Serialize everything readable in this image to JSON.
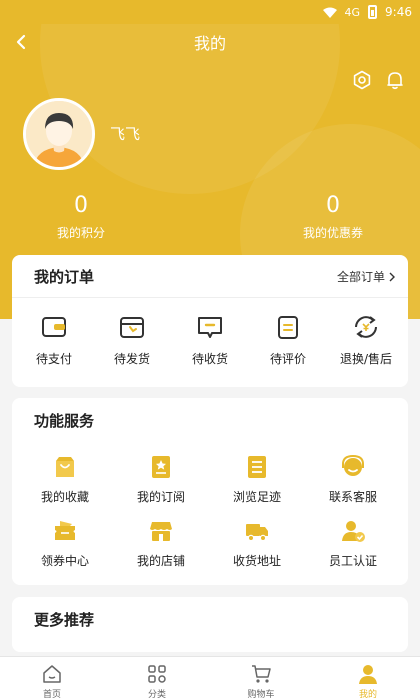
{
  "status_bar": {
    "time": "9:46",
    "signal_text": "4G"
  },
  "header": {
    "title": "我的"
  },
  "profile": {
    "username": "飞飞"
  },
  "stats": [
    {
      "value": "0",
      "label": "我的积分"
    },
    {
      "value": "0",
      "label": "我的优惠券"
    }
  ],
  "orders": {
    "title": "我的订单",
    "all_label": "全部订单",
    "items": [
      {
        "label": "待支付",
        "icon": "wallet-icon"
      },
      {
        "label": "待发货",
        "icon": "calendar-icon"
      },
      {
        "label": "待收货",
        "icon": "message-box-icon"
      },
      {
        "label": "待评价",
        "icon": "clipboard-icon"
      },
      {
        "label": "退换/售后",
        "icon": "exchange-icon"
      }
    ]
  },
  "services": {
    "title": "功能服务",
    "items": [
      {
        "label": "我的收藏",
        "icon": "bag-icon"
      },
      {
        "label": "我的订阅",
        "icon": "bookmark-star-icon"
      },
      {
        "label": "浏览足迹",
        "icon": "list-doc-icon"
      },
      {
        "label": "联系客服",
        "icon": "headset-icon"
      },
      {
        "label": "领券中心",
        "icon": "ticket-icon"
      },
      {
        "label": "我的店铺",
        "icon": "store-icon"
      },
      {
        "label": "收货地址",
        "icon": "truck-icon"
      },
      {
        "label": "员工认证",
        "icon": "user-check-icon"
      }
    ]
  },
  "more": {
    "title": "更多推荐"
  },
  "tabs": [
    {
      "label": "首页",
      "icon": "home-icon"
    },
    {
      "label": "分类",
      "icon": "grid-icon"
    },
    {
      "label": "购物车",
      "icon": "cart-icon"
    },
    {
      "label": "我的",
      "icon": "person-icon",
      "active": true
    }
  ],
  "colors": {
    "accent": "#e7b92c",
    "background": "#f4f4f4"
  }
}
